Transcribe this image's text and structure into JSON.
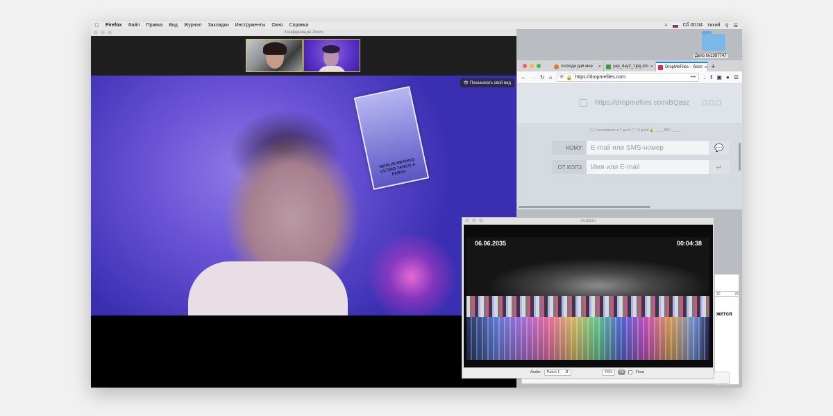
{
  "menubar": {
    "apple": "",
    "app": "Firefox",
    "items": [
      "Файл",
      "Правка",
      "Вид",
      "Журнал",
      "Закладки",
      "Инструменты",
      "Окно",
      "Справка"
    ],
    "clock": "Сб 00:04",
    "user": "тихий"
  },
  "zoom": {
    "title": "Конференция Zoom",
    "show_self_label": "Показывать свой вид",
    "poster_text": "MARLIN BRANDO ULTIMO TANGO A PARIGI"
  },
  "desktop": {
    "folder_label": "Дело №1397747"
  },
  "firefox": {
    "tabs": [
      {
        "label": "господи дай мне"
      },
      {
        "label": "yap_day2_f.jpg (по"
      },
      {
        "label": "DropMeFiles – бесп",
        "active": true
      }
    ],
    "url": "https://dropmefiles.com",
    "page": {
      "share_link": "https://dropmefiles.com/BQasz",
      "options_line": "◯ 1 скачивание   ● 7 дней   ◯ 14 дней   🔒 ____   ABC ____",
      "to_label": "КОМУ:",
      "to_placeholder": "E-mail или SMS-номер",
      "from_label": "ОТ КОГО:",
      "from_placeholder": "Имя или E-mail"
    }
  },
  "audition": {
    "title": "Audition",
    "date": "06.06.2035",
    "time": "00:04:38",
    "audio_label": "Audio:",
    "audio_value": "Patch 1",
    "zoom_value": "76%",
    "fit_label": "Fit",
    "float_label": "Float"
  },
  "background_window": {
    "ruler_left": "20",
    "ruler_right": "22",
    "partial_text": "жется"
  }
}
